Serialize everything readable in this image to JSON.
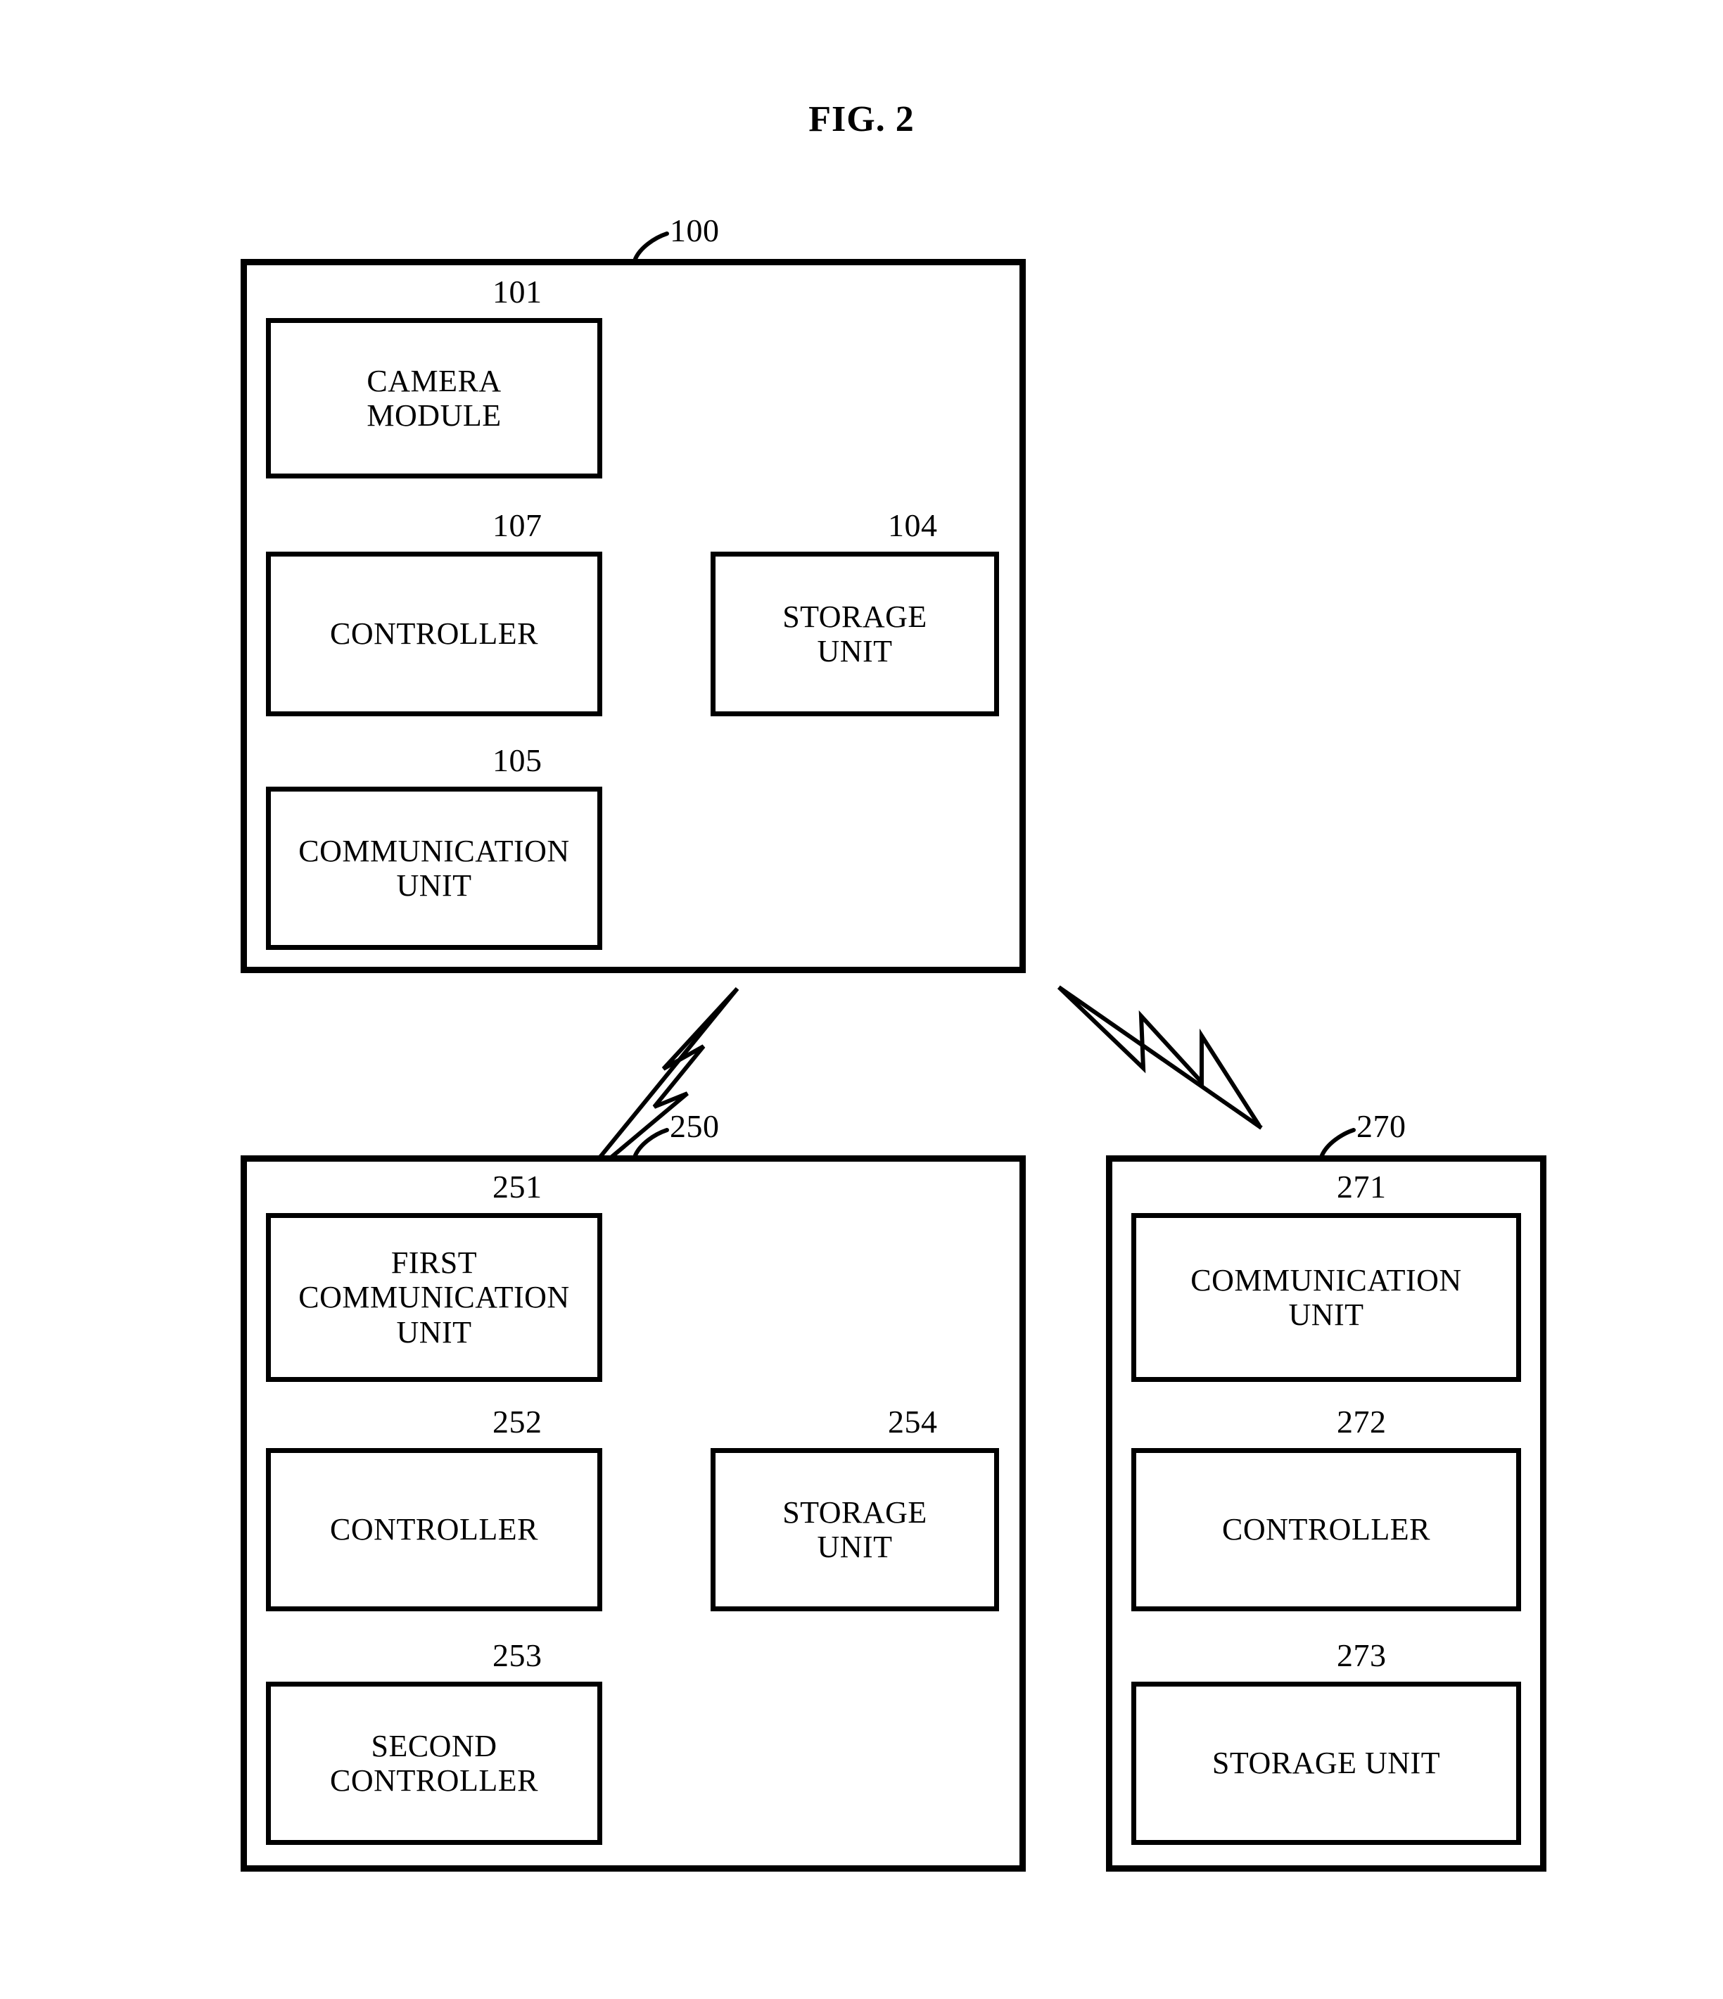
{
  "figure": {
    "title": "FIG. 2"
  },
  "devices": [
    {
      "ref": "100",
      "modules": [
        {
          "ref": "101",
          "label": "CAMERA\nMODULE"
        },
        {
          "ref": "107",
          "label": "CONTROLLER"
        },
        {
          "ref": "104",
          "label": "STORAGE\nUNIT"
        },
        {
          "ref": "105",
          "label": "COMMUNICATION\nUNIT"
        }
      ]
    },
    {
      "ref": "250",
      "modules": [
        {
          "ref": "251",
          "label": "FIRST\nCOMMUNICATION\nUNIT"
        },
        {
          "ref": "252",
          "label": "CONTROLLER"
        },
        {
          "ref": "254",
          "label": "STORAGE\nUNIT"
        },
        {
          "ref": "253",
          "label": "SECOND\nCONTROLLER"
        }
      ]
    },
    {
      "ref": "270",
      "modules": [
        {
          "ref": "271",
          "label": "COMMUNICATION\nUNIT"
        },
        {
          "ref": "272",
          "label": "CONTROLLER"
        },
        {
          "ref": "273",
          "label": "STORAGE UNIT"
        }
      ]
    }
  ],
  "links": [
    {
      "name": "wireless-link-left",
      "symbol": "lightning-bolt"
    },
    {
      "name": "wireless-link-right",
      "symbol": "lightning-bolt"
    }
  ],
  "style": {
    "stroke": "#000000",
    "background": "#ffffff"
  }
}
